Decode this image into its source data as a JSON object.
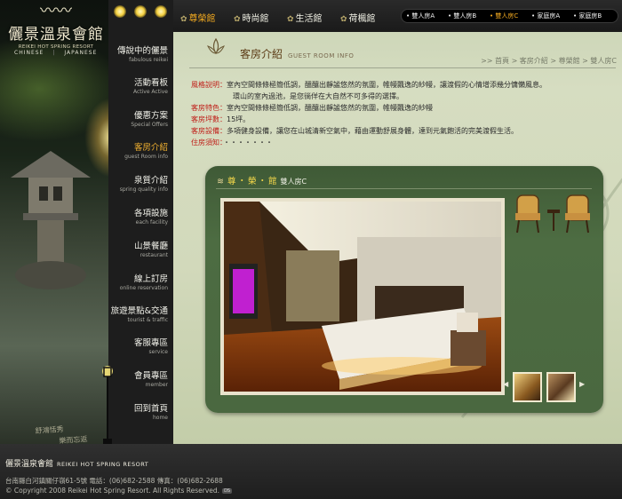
{
  "brand": {
    "name_zh": "儷景溫泉會館",
    "name_en": "REIKEI HOT SPRING RESORT",
    "lang_chinese": "CHINESE",
    "lang_japanese": "JAPANESE",
    "calligraphy_line1": "舒鴻恬秀",
    "calligraphy_line2": "樂而忘返"
  },
  "nav": [
    {
      "zh": "傳說中的儷景",
      "en": "fabulous reikei"
    },
    {
      "zh": "活動看板",
      "en": "Active Active"
    },
    {
      "zh": "優惠方案",
      "en": "Special Offers"
    },
    {
      "zh": "客房介紹",
      "en": "guest Room info"
    },
    {
      "zh": "泉質介紹",
      "en": "spring quality info"
    },
    {
      "zh": "各項設施",
      "en": "each facility"
    },
    {
      "zh": "山景餐廳",
      "en": "restaurant"
    },
    {
      "zh": "線上訂房",
      "en": "online reservation"
    },
    {
      "zh": "旅遊景點&交通",
      "en": "tourist & traffic"
    },
    {
      "zh": "客服專區",
      "en": "service"
    },
    {
      "zh": "會員專區",
      "en": "member"
    },
    {
      "zh": "回到首頁",
      "en": "home"
    }
  ],
  "tabs": [
    "尊榮館",
    "時尚館",
    "生活館",
    "荷楓館"
  ],
  "room_types": [
    "雙人房A",
    "雙人房B",
    "雙人房C",
    "家庭房A",
    "家庭房B"
  ],
  "section": {
    "title": "客房介紹",
    "title_en": "GUEST ROOM INFO"
  },
  "breadcrumb": [
    ">> 首頁",
    "> 客房介紹",
    "> 尊榮館",
    "> 雙人房C"
  ],
  "info": {
    "style_label": "風格說明：",
    "style_line1": "室內空間條條極簡低調，醞釀出靜謐悠然的氛圍，帷幔飄逸的紗幔，讓渡假的心情增添幾分慵懶風息。",
    "style_line2": "環山的室內過池，是您徜佯在大自然不可多得的選擇。",
    "feature_label": "客房特色：",
    "feature_text": "室內空間條條極簡低調，醞釀出靜謐悠然的氛圍，帷幔飄逸的紗幔",
    "size_label": "客房坪數：",
    "size_text": "15坪。",
    "facility_label": "客房設備：",
    "facility_text": "多項健身設備，讓您在山城清新空氣中，藉由運動舒展身體，達到元氣飽活的完美渡假生活。",
    "notice_label": "住房須知：",
    "notice_text": "・・・・・・・"
  },
  "panel": {
    "title": "尊・榮・館",
    "subtitle": "雙人房C"
  },
  "footer": {
    "brand_zh": "儷景溫泉會館",
    "brand_en": "REIKEI HOT SPRING RESORT",
    "address": "台南縣白河鎮關仔嶺61-5號  電話：(06)682-2588  傳真：(06)682-2688",
    "copyright": "© Copyright 2008 Reikei Hot Spring Resort. All Rights Reserved.",
    "badge": "DS"
  }
}
